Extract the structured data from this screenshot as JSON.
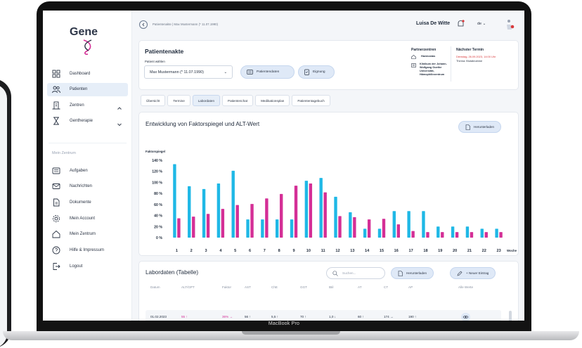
{
  "device": {
    "brand": "MacBook Pro"
  },
  "app": {
    "logo": "Gene",
    "breadcrumb": "Patientenakte | Max Mustermann (* 11.07.1990)",
    "user": {
      "name": "Luisa De Witte",
      "language": "de"
    }
  },
  "sidebar": {
    "items": [
      {
        "label": "Dashboard",
        "icon": "dashboard-icon"
      },
      {
        "label": "Patienten",
        "icon": "patients-icon"
      },
      {
        "label": "Zentren",
        "icon": "building-icon"
      },
      {
        "label": "Gentherapie",
        "icon": "hourglass-icon"
      }
    ],
    "section": "Mein Zentrum",
    "section_items": [
      {
        "label": "Aufgaben",
        "icon": "tasks-icon"
      },
      {
        "label": "Nachrichten",
        "icon": "mail-icon"
      },
      {
        "label": "Dokumente",
        "icon": "document-icon"
      },
      {
        "label": "Mein Account",
        "icon": "settings-icon"
      },
      {
        "label": "Mein Zentrum",
        "icon": "home-icon"
      },
      {
        "label": "Hilfe & Impressum",
        "icon": "help-icon"
      },
      {
        "label": "Logout",
        "icon": "logout-icon"
      }
    ]
  },
  "patient": {
    "title": "Patientenakte",
    "select_label": "Patient wählen",
    "selected": "Max Mustermann (* 11.07.1990)",
    "buttons": {
      "data": "Patientendaten",
      "fit": "Eignung"
    },
    "partner_title": "Partnerzentren",
    "partners": [
      {
        "name": "Haemostas"
      },
      {
        "name": "Klinikum der Johann-Wolfgang Goethe Universität, Hämophiliezentrum"
      }
    ],
    "next_title": "Nächster Termin",
    "next_date": "Dienstag, 26.09.2023, 14:00 Uhr",
    "next_theme": "Thema: Blutabnahme"
  },
  "tabs": [
    "Übersicht",
    "Termine",
    "Labordaten",
    "Patientenchat",
    "Medikationsplan",
    "Patiententagebuch"
  ],
  "active_tab": "Labordaten",
  "chart_section": {
    "title": "Entwicklung von Faktorspiegel und ALT-Wert",
    "download": "Herunterladen"
  },
  "chart_data": {
    "type": "bar",
    "ylabel": "Faktorspiegel",
    "xlabel": "Woche",
    "ylim": [
      0,
      140
    ],
    "yticks": [
      "0 %",
      "20 %",
      "40 %",
      "60 %",
      "80 %",
      "100 %",
      "120 %",
      "140 %"
    ],
    "categories": [
      "1",
      "2",
      "3",
      "4",
      "5",
      "6",
      "7",
      "8",
      "9",
      "10",
      "11",
      "12",
      "13",
      "14",
      "15",
      "16",
      "17",
      "18",
      "19",
      "20",
      "21",
      "22",
      "23"
    ],
    "series": [
      {
        "color": "#1fb8e6",
        "values": [
          133,
          93,
          88,
          98,
          121,
          33,
          33,
          33,
          33,
          103,
          108,
          74,
          46,
          16,
          16,
          48,
          48,
          48,
          20,
          20,
          20,
          16,
          16
        ]
      },
      {
        "color": "#d42f96",
        "values": [
          35,
          38,
          43,
          52,
          59,
          61,
          71,
          79,
          94,
          98,
          82,
          39,
          37,
          33,
          34,
          24,
          12,
          10,
          10,
          10,
          10,
          10,
          10
        ]
      }
    ]
  },
  "table": {
    "title": "Labordaten (Tabelle)",
    "search_placeholder": "Suchen...",
    "download": "Herunterladen",
    "new_entry": "+ Neuer Eintrag",
    "columns": [
      "Datum",
      "ALT/GPT",
      "Faktor",
      "AST",
      "ChE",
      "GGT",
      "tBil",
      "AT",
      "CT",
      "AP",
      "Alle Werte"
    ],
    "rows": [
      {
        "cells": [
          "01.02.2023",
          "55 ↑",
          "36% →",
          "56 ↑",
          "5,5 ↑",
          "70 ↑",
          "1,0 ↓",
          "60 ↑",
          "174 →",
          "190 ↑"
        ]
      }
    ]
  },
  "colors": {
    "accent": "#1fb8e6",
    "secondary": "#d42f96",
    "alert": "#d8393b",
    "button_bg": "#dfe9f7"
  }
}
